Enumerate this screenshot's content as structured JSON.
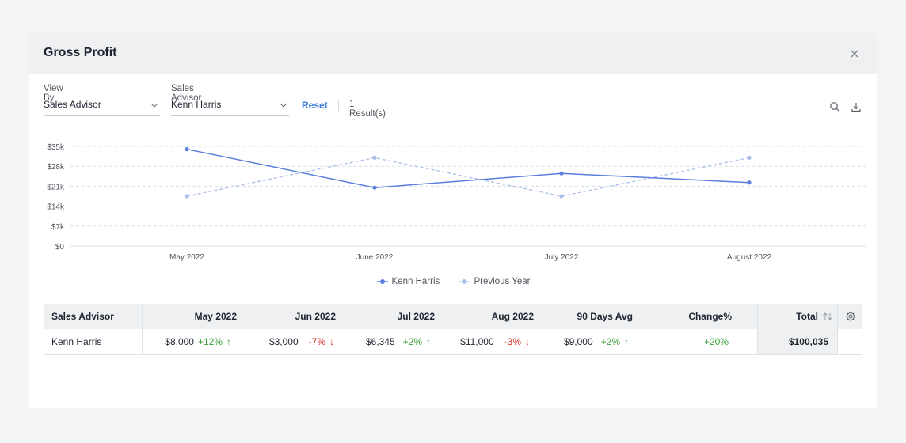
{
  "modal": {
    "title": "Gross Profit"
  },
  "filters": {
    "view_by": {
      "label": "View By",
      "value": "Sales Advisor"
    },
    "sales_advisor": {
      "label": "Sales Advisor",
      "value": "Kenn Harris"
    },
    "reset_label": "Reset",
    "results_text": "1 Result(s)"
  },
  "chart_data": {
    "type": "line",
    "categories": [
      "May 2022",
      "June 2022",
      "July 2022",
      "August 2022"
    ],
    "y_ticks": [
      "$35k",
      "$28k",
      "$21k",
      "$14k",
      "$7k",
      "$0"
    ],
    "ylim": [
      0,
      35000
    ],
    "grid": true,
    "legend_position": "bottom-center",
    "series": [
      {
        "name": "Kenn Harris",
        "values": [
          34000,
          20500,
          25500,
          22300
        ],
        "color": "#5b7fde",
        "style": "solid"
      },
      {
        "name": "Previous Year",
        "values": [
          17500,
          31000,
          17500,
          31000
        ],
        "color": "#a9bdea",
        "style": "dashed"
      }
    ]
  },
  "table": {
    "headers": {
      "advisor": "Sales Advisor",
      "may": "May 2022",
      "jun": "Jun 2022",
      "jul": "Jul 2022",
      "aug": "Aug 2022",
      "avg": "90 Days Avg",
      "change": "Change%",
      "total": "Total"
    },
    "rows": [
      {
        "advisor": "Kenn Harris",
        "may": {
          "value": "$8,000",
          "delta": "+12%",
          "dir": "up"
        },
        "jun": {
          "value": "$3,000",
          "delta": "-7%",
          "dir": "down"
        },
        "jul": {
          "value": "$6,345",
          "delta": "+2%",
          "dir": "up"
        },
        "aug": {
          "value": "$11,000",
          "delta": "-3%",
          "dir": "down"
        },
        "avg": {
          "value": "$9,000",
          "delta": "+2%",
          "dir": "up"
        },
        "change": "+20%",
        "total": "$100,035"
      }
    ]
  },
  "icons": {
    "close": "close-icon",
    "search": "search-icon",
    "download": "download-icon",
    "sort": "sort-icon",
    "settings": "gear-icon"
  }
}
